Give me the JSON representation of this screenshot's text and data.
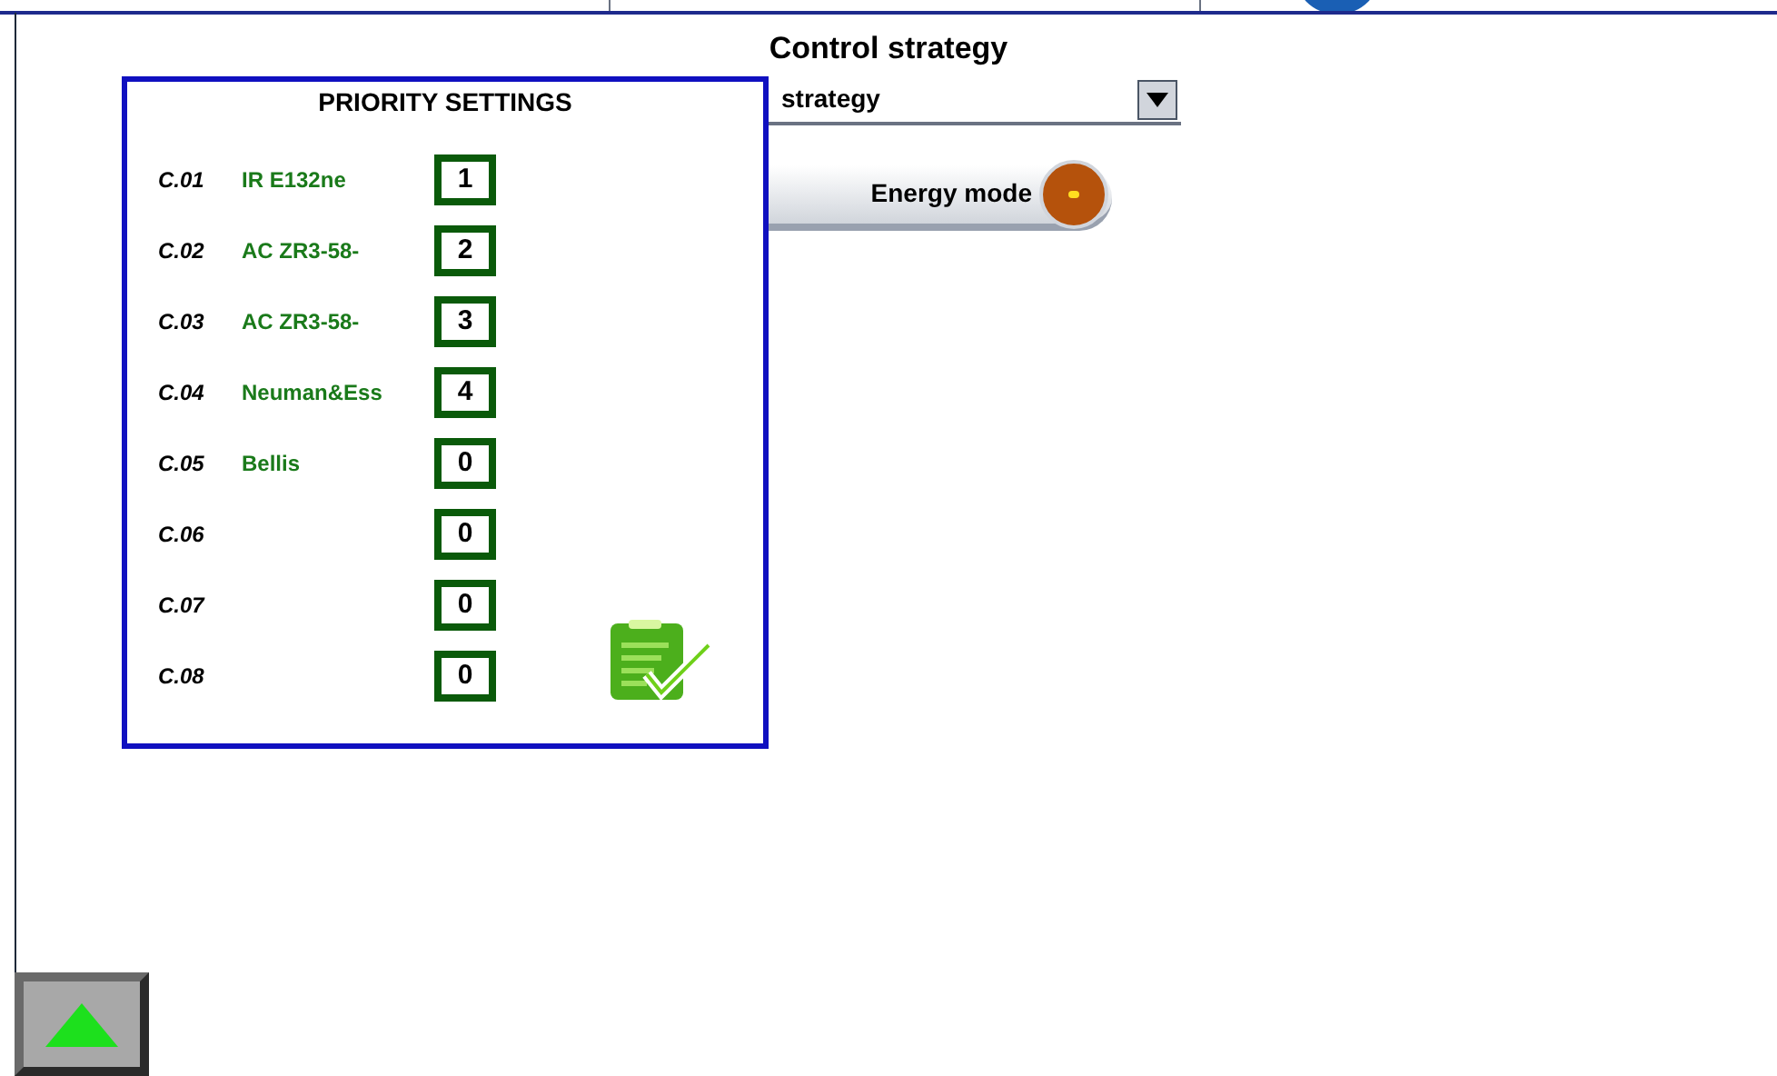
{
  "title": "Control strategy",
  "strategy_dropdown": {
    "value": "strategy"
  },
  "energy_mode_toggle": {
    "label": "Energy mode",
    "on": false
  },
  "priority_settings": {
    "title": "PRIORITY SETTINGS",
    "rows": [
      {
        "code": "C.01",
        "name": "IR E132ne",
        "priority": "1"
      },
      {
        "code": "C.02",
        "name": "AC ZR3-58-",
        "priority": "2"
      },
      {
        "code": "C.03",
        "name": "AC ZR3-58-",
        "priority": "3"
      },
      {
        "code": "C.04",
        "name": "Neuman&Ess",
        "priority": "4"
      },
      {
        "code": "C.05",
        "name": "Bellis",
        "priority": "0"
      },
      {
        "code": "C.06",
        "priority": "0"
      },
      {
        "code": "C.07",
        "priority": "0"
      },
      {
        "code": "C.08",
        "priority": "0"
      }
    ]
  }
}
